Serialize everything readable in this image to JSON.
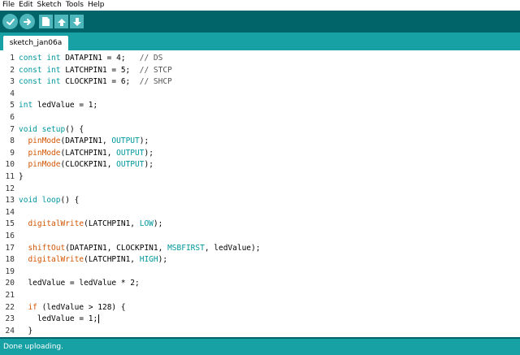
{
  "menu": [
    "File",
    "Edit",
    "Sketch",
    "Tools",
    "Help"
  ],
  "toolbar": {
    "buttons": [
      {
        "name": "verify-button",
        "icon": "checkmark-icon"
      },
      {
        "name": "upload-button",
        "icon": "arrow-right-icon"
      },
      {
        "name": "new-button",
        "icon": "new-file-icon"
      },
      {
        "name": "open-button",
        "icon": "arrow-up-icon"
      },
      {
        "name": "save-button",
        "icon": "arrow-down-icon"
      }
    ]
  },
  "tab": {
    "label": "sketch_jan06a"
  },
  "code": {
    "lines": [
      {
        "n": "1",
        "segs": [
          {
            "t": "const int ",
            "c": "kw-type"
          },
          {
            "t": "DATAPIN1 = 4;   ",
            "c": ""
          },
          {
            "t": "// DS",
            "c": "cmt"
          }
        ]
      },
      {
        "n": "2",
        "segs": [
          {
            "t": "const int ",
            "c": "kw-type"
          },
          {
            "t": "LATCHPIN1 = 5;  ",
            "c": ""
          },
          {
            "t": "// STCP",
            "c": "cmt"
          }
        ]
      },
      {
        "n": "3",
        "segs": [
          {
            "t": "const int ",
            "c": "kw-type"
          },
          {
            "t": "CLOCKPIN1 = 6;  ",
            "c": ""
          },
          {
            "t": "// SHCP",
            "c": "cmt"
          }
        ]
      },
      {
        "n": "4",
        "segs": []
      },
      {
        "n": "5",
        "segs": [
          {
            "t": "int ",
            "c": "kw-type"
          },
          {
            "t": "ledValue = 1;",
            "c": ""
          }
        ]
      },
      {
        "n": "6",
        "segs": []
      },
      {
        "n": "7",
        "segs": [
          {
            "t": "void ",
            "c": "kw-type"
          },
          {
            "t": "setup",
            "c": "kw-type"
          },
          {
            "t": "() {",
            "c": ""
          }
        ]
      },
      {
        "n": "8",
        "segs": [
          {
            "t": "  ",
            "c": ""
          },
          {
            "t": "pinMode",
            "c": "kw-fn"
          },
          {
            "t": "(DATAPIN1, ",
            "c": ""
          },
          {
            "t": "OUTPUT",
            "c": "kw-const"
          },
          {
            "t": ");",
            "c": ""
          }
        ]
      },
      {
        "n": "9",
        "segs": [
          {
            "t": "  ",
            "c": ""
          },
          {
            "t": "pinMode",
            "c": "kw-fn"
          },
          {
            "t": "(LATCHPIN1, ",
            "c": ""
          },
          {
            "t": "OUTPUT",
            "c": "kw-const"
          },
          {
            "t": ");",
            "c": ""
          }
        ]
      },
      {
        "n": "10",
        "segs": [
          {
            "t": "  ",
            "c": ""
          },
          {
            "t": "pinMode",
            "c": "kw-fn"
          },
          {
            "t": "(CLOCKPIN1, ",
            "c": ""
          },
          {
            "t": "OUTPUT",
            "c": "kw-const"
          },
          {
            "t": ");",
            "c": ""
          }
        ]
      },
      {
        "n": "11",
        "segs": [
          {
            "t": "}",
            "c": ""
          }
        ]
      },
      {
        "n": "12",
        "segs": []
      },
      {
        "n": "13",
        "segs": [
          {
            "t": "void ",
            "c": "kw-type"
          },
          {
            "t": "loop",
            "c": "kw-type"
          },
          {
            "t": "() {",
            "c": ""
          }
        ]
      },
      {
        "n": "14",
        "segs": []
      },
      {
        "n": "15",
        "segs": [
          {
            "t": "  ",
            "c": ""
          },
          {
            "t": "digitalWrite",
            "c": "kw-fn"
          },
          {
            "t": "(LATCHPIN1, ",
            "c": ""
          },
          {
            "t": "LOW",
            "c": "kw-const"
          },
          {
            "t": ");",
            "c": ""
          }
        ]
      },
      {
        "n": "16",
        "segs": []
      },
      {
        "n": "17",
        "segs": [
          {
            "t": "  ",
            "c": ""
          },
          {
            "t": "shiftOut",
            "c": "kw-fn"
          },
          {
            "t": "(DATAPIN1, CLOCKPIN1, ",
            "c": ""
          },
          {
            "t": "MSBFIRST",
            "c": "kw-const"
          },
          {
            "t": ", ledValue);",
            "c": ""
          }
        ]
      },
      {
        "n": "18",
        "segs": [
          {
            "t": "  ",
            "c": ""
          },
          {
            "t": "digitalWrite",
            "c": "kw-fn"
          },
          {
            "t": "(LATCHPIN1, ",
            "c": ""
          },
          {
            "t": "HIGH",
            "c": "kw-const"
          },
          {
            "t": ");",
            "c": ""
          }
        ]
      },
      {
        "n": "19",
        "segs": []
      },
      {
        "n": "20",
        "segs": [
          {
            "t": "  ledValue = ledValue * 2;",
            "c": ""
          }
        ]
      },
      {
        "n": "21",
        "segs": []
      },
      {
        "n": "22",
        "segs": [
          {
            "t": "  ",
            "c": ""
          },
          {
            "t": "if",
            "c": "kw-fn"
          },
          {
            "t": " (ledValue > 128) {",
            "c": ""
          }
        ]
      },
      {
        "n": "23",
        "segs": [
          {
            "t": "    ledValue = 1;",
            "c": ""
          }
        ],
        "caret": true
      },
      {
        "n": "24",
        "segs": [
          {
            "t": "  }",
            "c": ""
          }
        ]
      }
    ]
  },
  "status": {
    "text": "Done uploading."
  }
}
